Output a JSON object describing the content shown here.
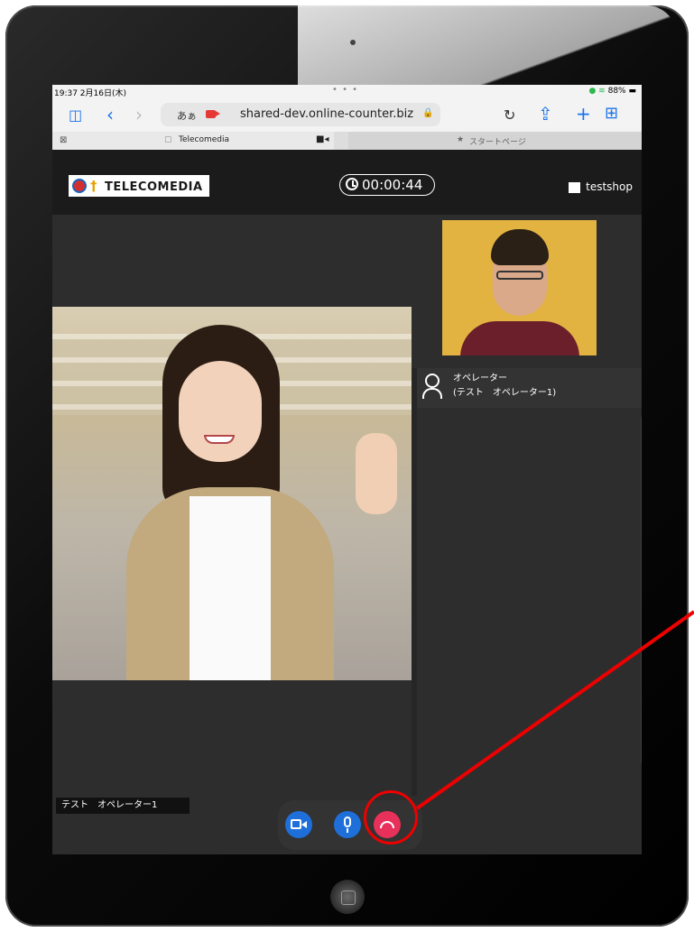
{
  "status_bar": {
    "time": "19:37  2月16日(木)",
    "dots": "• • •",
    "battery": "88%"
  },
  "browser": {
    "input_mode": "あぁ",
    "url": "shared-dev.online-counter.biz",
    "tabs": [
      {
        "label": "Telecomedia"
      },
      {
        "label": "スタートページ"
      }
    ]
  },
  "app": {
    "logo_text": "TELECOMEDIA",
    "timer": "00:00:44",
    "shop": "testshop",
    "operator_role": "オペレーター",
    "operator_name": "(テスト　オペレーター1)",
    "self_name_label": "テスト　オペレーター1"
  },
  "controls": {
    "video": "camera-toggle",
    "mic": "microphone-toggle",
    "hangup": "end-call"
  },
  "colors": {
    "header_bg": "#1b1b1b",
    "main_bg": "#2d2d2d",
    "button_blue": "#1e6fd9",
    "hangup_red": "#e8315a",
    "annotation_red": "#ee0000"
  }
}
